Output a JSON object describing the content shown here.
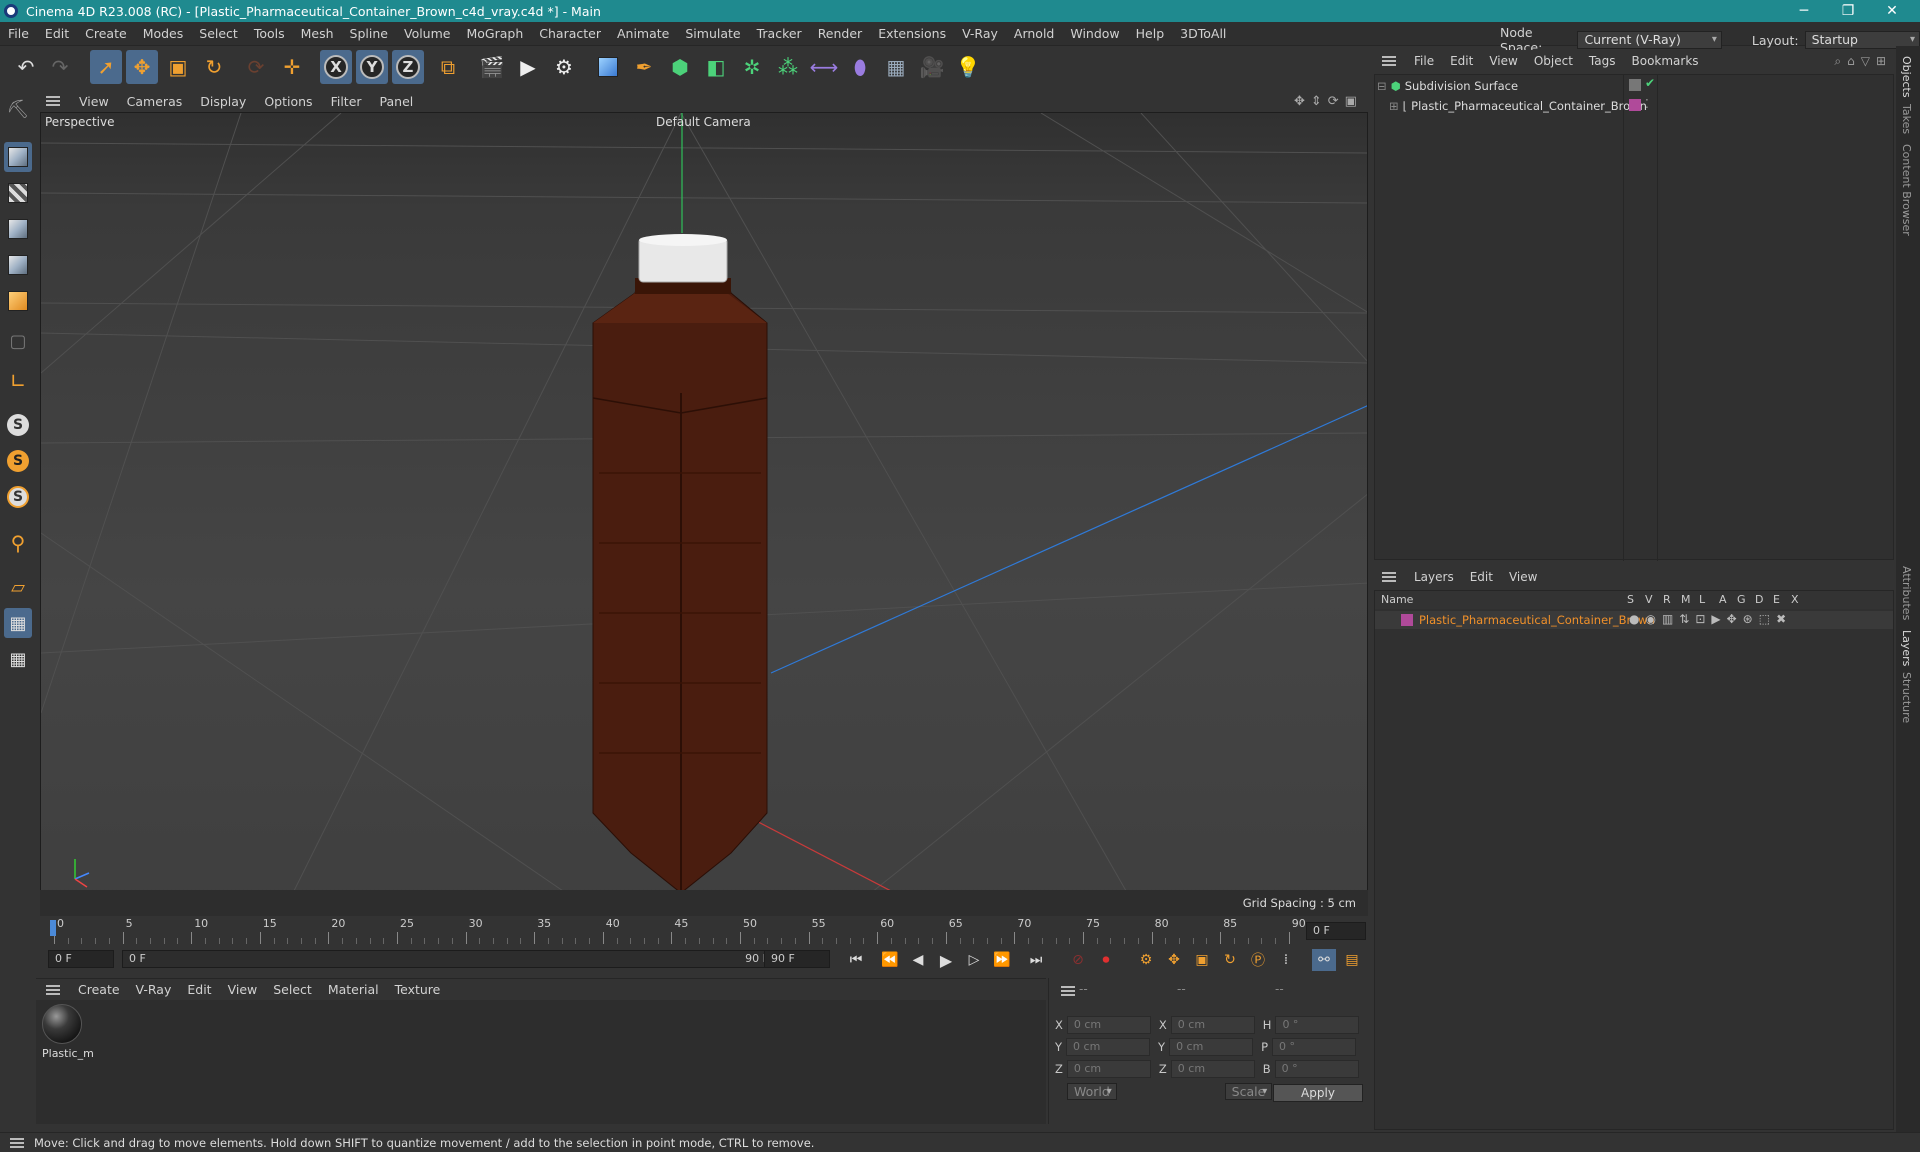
{
  "window": {
    "title": "Cinema 4D R23.008 (RC) - [Plastic_Pharmaceutical_Container_Brown_c4d_vray.c4d *] - Main",
    "minimize": "─",
    "restore": "❐",
    "close": "✕"
  },
  "menubar": {
    "items": [
      "File",
      "Edit",
      "Create",
      "Modes",
      "Select",
      "Tools",
      "Mesh",
      "Spline",
      "Volume",
      "MoGraph",
      "Character",
      "Animate",
      "Simulate",
      "Tracker",
      "Render",
      "Extensions",
      "V-Ray",
      "Arnold",
      "Window",
      "Help",
      "3DToAll"
    ],
    "node_space_label": "Node Space:",
    "node_space_value": "Current (V-Ray)",
    "layout_label": "Layout:",
    "layout_value": "Startup"
  },
  "toolbar": {
    "axis_x": "X",
    "axis_y": "Y",
    "axis_z": "Z"
  },
  "viewport": {
    "menu": [
      "View",
      "Cameras",
      "Display",
      "Options",
      "Filter",
      "Panel"
    ],
    "label": "Perspective",
    "camera": "Default Camera",
    "grid_spacing": "Grid Spacing : 5 cm"
  },
  "timeline": {
    "ticks": [
      "0",
      "5",
      "10",
      "15",
      "20",
      "25",
      "30",
      "35",
      "40",
      "45",
      "50",
      "55",
      "60",
      "65",
      "70",
      "75",
      "80",
      "85",
      "90"
    ],
    "end_field": "0 F",
    "start_field": "0 F",
    "range_start": "0 F",
    "range_end": "90 F",
    "max_field": "90 F"
  },
  "materials": {
    "menu": [
      "Create",
      "V-Ray",
      "Edit",
      "View",
      "Select",
      "Material",
      "Texture"
    ],
    "items": [
      {
        "name": "Plastic_m"
      }
    ]
  },
  "coords": {
    "header": [
      "--",
      "--",
      "--"
    ],
    "rows": [
      {
        "a": "X",
        "v1": "0 cm",
        "b": "X",
        "v2": "0 cm",
        "c": "H",
        "v3": "0 °"
      },
      {
        "a": "Y",
        "v1": "0 cm",
        "b": "Y",
        "v2": "0 cm",
        "c": "P",
        "v3": "0 °"
      },
      {
        "a": "Z",
        "v1": "0 cm",
        "b": "Z",
        "v2": "0 cm",
        "c": "B",
        "v3": "0 °"
      }
    ],
    "world": "World",
    "scale": "Scale",
    "apply": "Apply"
  },
  "objects": {
    "menu": [
      "File",
      "Edit",
      "View",
      "Object",
      "Tags",
      "Bookmarks"
    ],
    "items": [
      {
        "name": "Subdivision Surface"
      },
      {
        "name": "Plastic_Pharmaceutical_Container_Brown"
      }
    ]
  },
  "layers": {
    "menu": [
      "Layers",
      "Edit",
      "View"
    ],
    "columns": [
      "Name",
      "S",
      "V",
      "R",
      "M",
      "L",
      "A",
      "G",
      "D",
      "E",
      "X"
    ],
    "items": [
      {
        "name": "Plastic_Pharmaceutical_Container_Brown",
        "color": "#b04a9a"
      }
    ]
  },
  "sidetabs": [
    "Objects",
    "Takes",
    "Content Browser",
    "Attributes",
    "Layers",
    "Structure"
  ],
  "status": "Move: Click and drag to move elements. Hold down SHIFT to quantize movement / add to the selection in point mode, CTRL to remove.",
  "colors": {
    "titlebar": "#1f8a8f",
    "accent": "#4b6a8d",
    "layer_text": "#f0902a",
    "bottle": "#4a1d0f"
  }
}
